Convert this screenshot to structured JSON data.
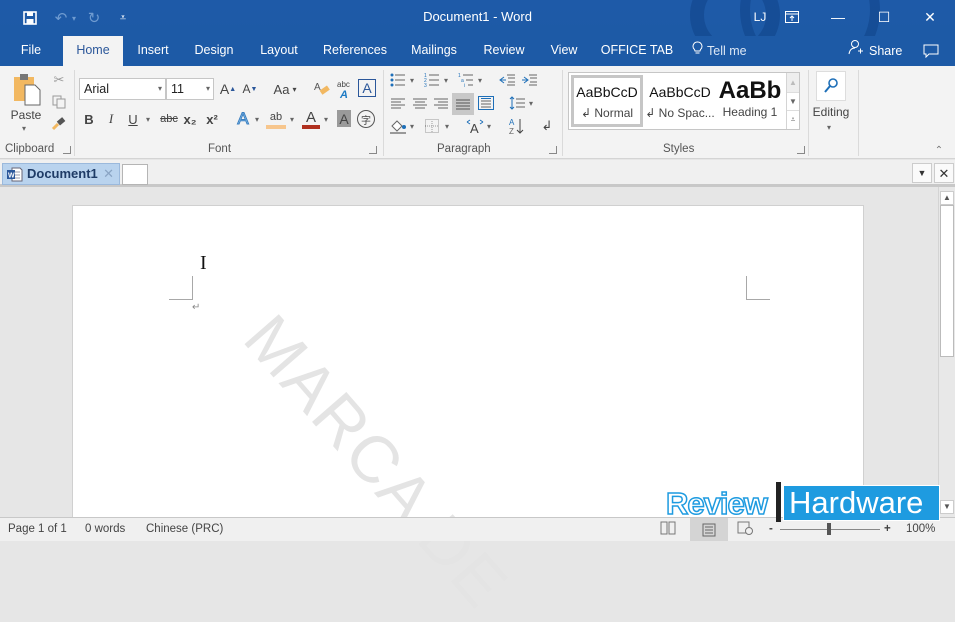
{
  "window": {
    "title": "Document1  -  Word",
    "user_initials": "LJ",
    "colors": {
      "title_bar": "#1d5aa6",
      "ribbon": "#f3f3f3",
      "doc_tab": "#b9d3ee",
      "brand_blue": "#1e9be0"
    }
  },
  "quick_access": [
    {
      "icon": "save-icon",
      "glyph": "💾"
    },
    {
      "icon": "undo-icon",
      "glyph": "↶"
    },
    {
      "icon": "redo-icon",
      "glyph": "↻"
    },
    {
      "icon": "customize-qat-icon",
      "glyph": "="
    }
  ],
  "window_controls": {
    "ribbon_display": "▭",
    "minimize": "—",
    "maximize": "☐",
    "close": "✕"
  },
  "menu_tabs": [
    {
      "label": "File"
    },
    {
      "label": "Home",
      "active": true
    },
    {
      "label": "Insert"
    },
    {
      "label": "Design"
    },
    {
      "label": "Layout"
    },
    {
      "label": "References"
    },
    {
      "label": "Mailings"
    },
    {
      "label": "Review"
    },
    {
      "label": "View"
    },
    {
      "label": "OFFICE TAB"
    }
  ],
  "tell_me": "Tell me",
  "share": "Share",
  "ribbon": {
    "clipboard": {
      "label": "Clipboard",
      "paste": "Paste"
    },
    "font": {
      "label": "Font",
      "font_name": "Arial",
      "font_size": "11",
      "grow": "A",
      "shrink": "A",
      "change_case": "Aa",
      "bold": "B",
      "italic": "I",
      "underline": "U",
      "strikethrough": "abc",
      "subscript": "x₂",
      "superscript": "x²",
      "text_effects": "A",
      "highlight": "ab",
      "font_color": "A",
      "char_shading": "A",
      "enclose": "字"
    },
    "paragraph": {
      "label": "Paragraph"
    },
    "styles": {
      "label": "Styles",
      "items": [
        {
          "preview": "AaBbCcD",
          "name": "↲ Normal",
          "selected": true
        },
        {
          "preview": "AaBbCcD",
          "name": "↲ No Spac...",
          "selected": false
        },
        {
          "preview": "AaBb",
          "name": "Heading 1",
          "selected": false
        }
      ]
    },
    "editing": {
      "label": "Editing"
    }
  },
  "doc_tabs": [
    {
      "label": "Document1"
    }
  ],
  "document": {
    "paragraph_mark": "↵",
    "watermark": "MARCA DE"
  },
  "status": {
    "page": "Page 1 of 1",
    "words": "0 words",
    "language": "Chinese (PRC)",
    "zoom_minus": "-",
    "zoom_plus": "+",
    "zoom": "100%",
    "zoom_level_percent": 100
  },
  "brand_overlay": {
    "left": "Review",
    "right": "Hardware"
  }
}
